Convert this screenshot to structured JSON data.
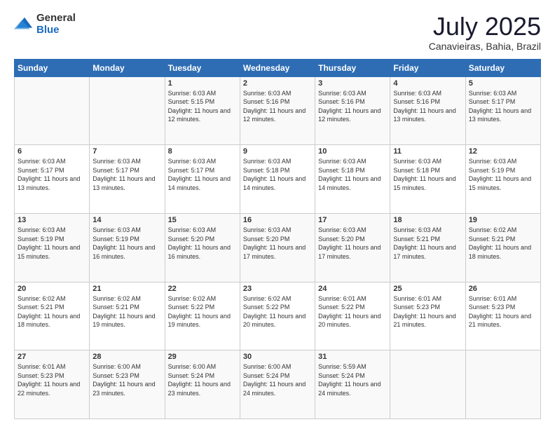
{
  "header": {
    "logo_general": "General",
    "logo_blue": "Blue",
    "month_year": "July 2025",
    "location": "Canavieiras, Bahia, Brazil"
  },
  "days_of_week": [
    "Sunday",
    "Monday",
    "Tuesday",
    "Wednesday",
    "Thursday",
    "Friday",
    "Saturday"
  ],
  "weeks": [
    [
      {
        "num": "",
        "info": ""
      },
      {
        "num": "",
        "info": ""
      },
      {
        "num": "1",
        "info": "Sunrise: 6:03 AM\nSunset: 5:15 PM\nDaylight: 11 hours and 12 minutes."
      },
      {
        "num": "2",
        "info": "Sunrise: 6:03 AM\nSunset: 5:16 PM\nDaylight: 11 hours and 12 minutes."
      },
      {
        "num": "3",
        "info": "Sunrise: 6:03 AM\nSunset: 5:16 PM\nDaylight: 11 hours and 12 minutes."
      },
      {
        "num": "4",
        "info": "Sunrise: 6:03 AM\nSunset: 5:16 PM\nDaylight: 11 hours and 13 minutes."
      },
      {
        "num": "5",
        "info": "Sunrise: 6:03 AM\nSunset: 5:17 PM\nDaylight: 11 hours and 13 minutes."
      }
    ],
    [
      {
        "num": "6",
        "info": "Sunrise: 6:03 AM\nSunset: 5:17 PM\nDaylight: 11 hours and 13 minutes."
      },
      {
        "num": "7",
        "info": "Sunrise: 6:03 AM\nSunset: 5:17 PM\nDaylight: 11 hours and 13 minutes."
      },
      {
        "num": "8",
        "info": "Sunrise: 6:03 AM\nSunset: 5:17 PM\nDaylight: 11 hours and 14 minutes."
      },
      {
        "num": "9",
        "info": "Sunrise: 6:03 AM\nSunset: 5:18 PM\nDaylight: 11 hours and 14 minutes."
      },
      {
        "num": "10",
        "info": "Sunrise: 6:03 AM\nSunset: 5:18 PM\nDaylight: 11 hours and 14 minutes."
      },
      {
        "num": "11",
        "info": "Sunrise: 6:03 AM\nSunset: 5:18 PM\nDaylight: 11 hours and 15 minutes."
      },
      {
        "num": "12",
        "info": "Sunrise: 6:03 AM\nSunset: 5:19 PM\nDaylight: 11 hours and 15 minutes."
      }
    ],
    [
      {
        "num": "13",
        "info": "Sunrise: 6:03 AM\nSunset: 5:19 PM\nDaylight: 11 hours and 15 minutes."
      },
      {
        "num": "14",
        "info": "Sunrise: 6:03 AM\nSunset: 5:19 PM\nDaylight: 11 hours and 16 minutes."
      },
      {
        "num": "15",
        "info": "Sunrise: 6:03 AM\nSunset: 5:20 PM\nDaylight: 11 hours and 16 minutes."
      },
      {
        "num": "16",
        "info": "Sunrise: 6:03 AM\nSunset: 5:20 PM\nDaylight: 11 hours and 17 minutes."
      },
      {
        "num": "17",
        "info": "Sunrise: 6:03 AM\nSunset: 5:20 PM\nDaylight: 11 hours and 17 minutes."
      },
      {
        "num": "18",
        "info": "Sunrise: 6:03 AM\nSunset: 5:21 PM\nDaylight: 11 hours and 17 minutes."
      },
      {
        "num": "19",
        "info": "Sunrise: 6:02 AM\nSunset: 5:21 PM\nDaylight: 11 hours and 18 minutes."
      }
    ],
    [
      {
        "num": "20",
        "info": "Sunrise: 6:02 AM\nSunset: 5:21 PM\nDaylight: 11 hours and 18 minutes."
      },
      {
        "num": "21",
        "info": "Sunrise: 6:02 AM\nSunset: 5:21 PM\nDaylight: 11 hours and 19 minutes."
      },
      {
        "num": "22",
        "info": "Sunrise: 6:02 AM\nSunset: 5:22 PM\nDaylight: 11 hours and 19 minutes."
      },
      {
        "num": "23",
        "info": "Sunrise: 6:02 AM\nSunset: 5:22 PM\nDaylight: 11 hours and 20 minutes."
      },
      {
        "num": "24",
        "info": "Sunrise: 6:01 AM\nSunset: 5:22 PM\nDaylight: 11 hours and 20 minutes."
      },
      {
        "num": "25",
        "info": "Sunrise: 6:01 AM\nSunset: 5:23 PM\nDaylight: 11 hours and 21 minutes."
      },
      {
        "num": "26",
        "info": "Sunrise: 6:01 AM\nSunset: 5:23 PM\nDaylight: 11 hours and 21 minutes."
      }
    ],
    [
      {
        "num": "27",
        "info": "Sunrise: 6:01 AM\nSunset: 5:23 PM\nDaylight: 11 hours and 22 minutes."
      },
      {
        "num": "28",
        "info": "Sunrise: 6:00 AM\nSunset: 5:23 PM\nDaylight: 11 hours and 23 minutes."
      },
      {
        "num": "29",
        "info": "Sunrise: 6:00 AM\nSunset: 5:24 PM\nDaylight: 11 hours and 23 minutes."
      },
      {
        "num": "30",
        "info": "Sunrise: 6:00 AM\nSunset: 5:24 PM\nDaylight: 11 hours and 24 minutes."
      },
      {
        "num": "31",
        "info": "Sunrise: 5:59 AM\nSunset: 5:24 PM\nDaylight: 11 hours and 24 minutes."
      },
      {
        "num": "",
        "info": ""
      },
      {
        "num": "",
        "info": ""
      }
    ]
  ]
}
